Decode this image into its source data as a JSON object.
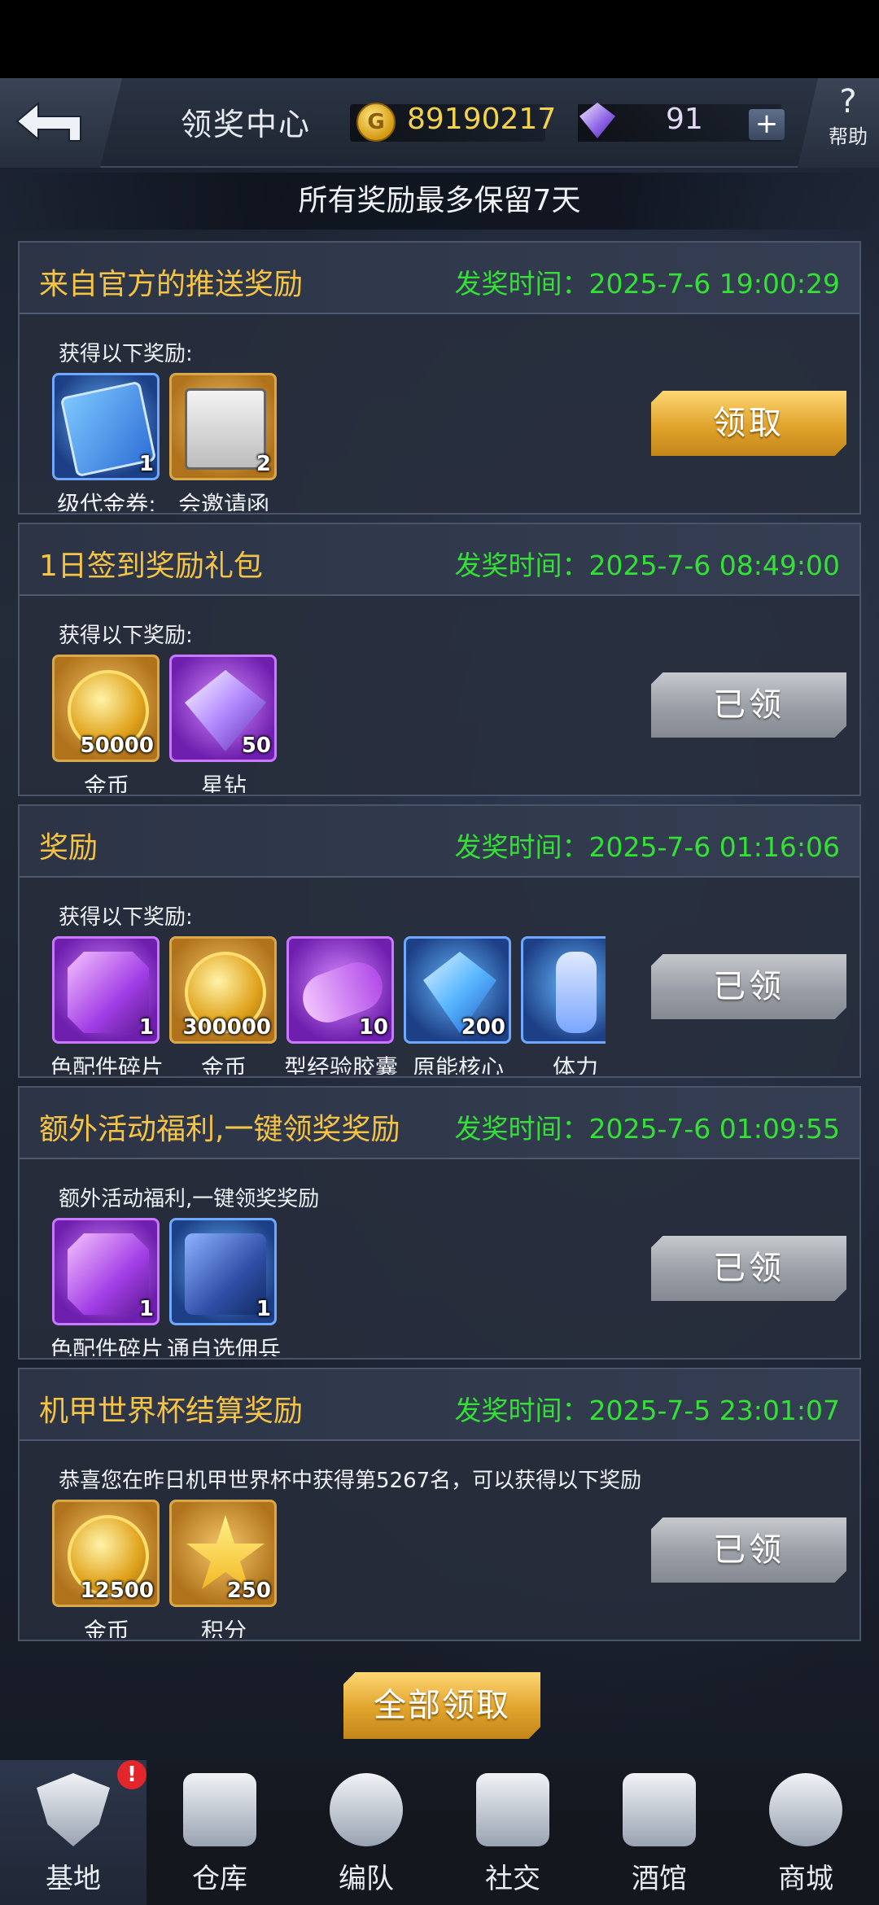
{
  "header": {
    "title": "领奖中心",
    "gold": "89190217",
    "gems": "91",
    "plus": "+",
    "help_label": "帮助",
    "help_symbol": "?"
  },
  "notice": "所有奖励最多保留7天",
  "cards": [
    {
      "title": "来自官方的推送奖励",
      "time": "发奖时间：2025-7-6 19:00:29",
      "subtitle": "获得以下奖励:",
      "button": "领取",
      "items": [
        {
          "icon": "coupon-cards",
          "count": "1",
          "name": "级代金券:"
        },
        {
          "icon": "invitation-card",
          "count": "2",
          "name": "会邀请函"
        }
      ]
    },
    {
      "title": "1日签到奖励礼包",
      "time": "发奖时间：2025-7-6 08:49:00",
      "subtitle": "获得以下奖励:",
      "button": "已领",
      "items": [
        {
          "icon": "gold-coins",
          "count": "50000",
          "name": "金币"
        },
        {
          "icon": "star-diamond",
          "count": "50",
          "name": "星钻"
        }
      ]
    },
    {
      "title": "奖励",
      "time": "发奖时间：2025-7-6 01:16:06",
      "subtitle": "获得以下奖励:",
      "button": "已领",
      "items": [
        {
          "icon": "part-fragment",
          "count": "1",
          "name": "色配件碎片"
        },
        {
          "icon": "gold-coins",
          "count": "300000",
          "name": "金币"
        },
        {
          "icon": "exp-capsule",
          "count": "10",
          "name": "型经验胶囊"
        },
        {
          "icon": "energy-core",
          "count": "200",
          "name": "原能核心"
        },
        {
          "icon": "stamina",
          "count": "",
          "name": "体力"
        }
      ]
    },
    {
      "title": "额外活动福利,一键领奖奖励",
      "time": "发奖时间：2025-7-6 01:09:55",
      "subtitle": "额外活动福利,一键领奖奖励",
      "button": "已领",
      "items": [
        {
          "icon": "part-fragment",
          "count": "1",
          "name": "色配件碎片"
        },
        {
          "icon": "mech-box",
          "count": "1",
          "name": "通自选佣兵"
        }
      ]
    },
    {
      "title": "机甲世界杯结算奖励",
      "time": "发奖时间：2025-7-5 23:01:07",
      "subtitle": "恭喜您在昨日机甲世界杯中获得第5267名，可以获得以下奖励",
      "button": "已领",
      "items": [
        {
          "icon": "gold-coins",
          "count": "12500",
          "name": "金币"
        },
        {
          "icon": "star-points",
          "count": "250",
          "name": "积分"
        }
      ]
    }
  ],
  "claim_all": "全部领取",
  "nav": [
    {
      "label": "基地",
      "icon": "base-emblem-icon",
      "badge": "!"
    },
    {
      "label": "仓库",
      "icon": "warehouse-icon"
    },
    {
      "label": "编队",
      "icon": "squad-icon"
    },
    {
      "label": "社交",
      "icon": "handshake-icon"
    },
    {
      "label": "酒馆",
      "icon": "tavern-icon"
    },
    {
      "label": "商城",
      "icon": "shop-icon"
    }
  ]
}
